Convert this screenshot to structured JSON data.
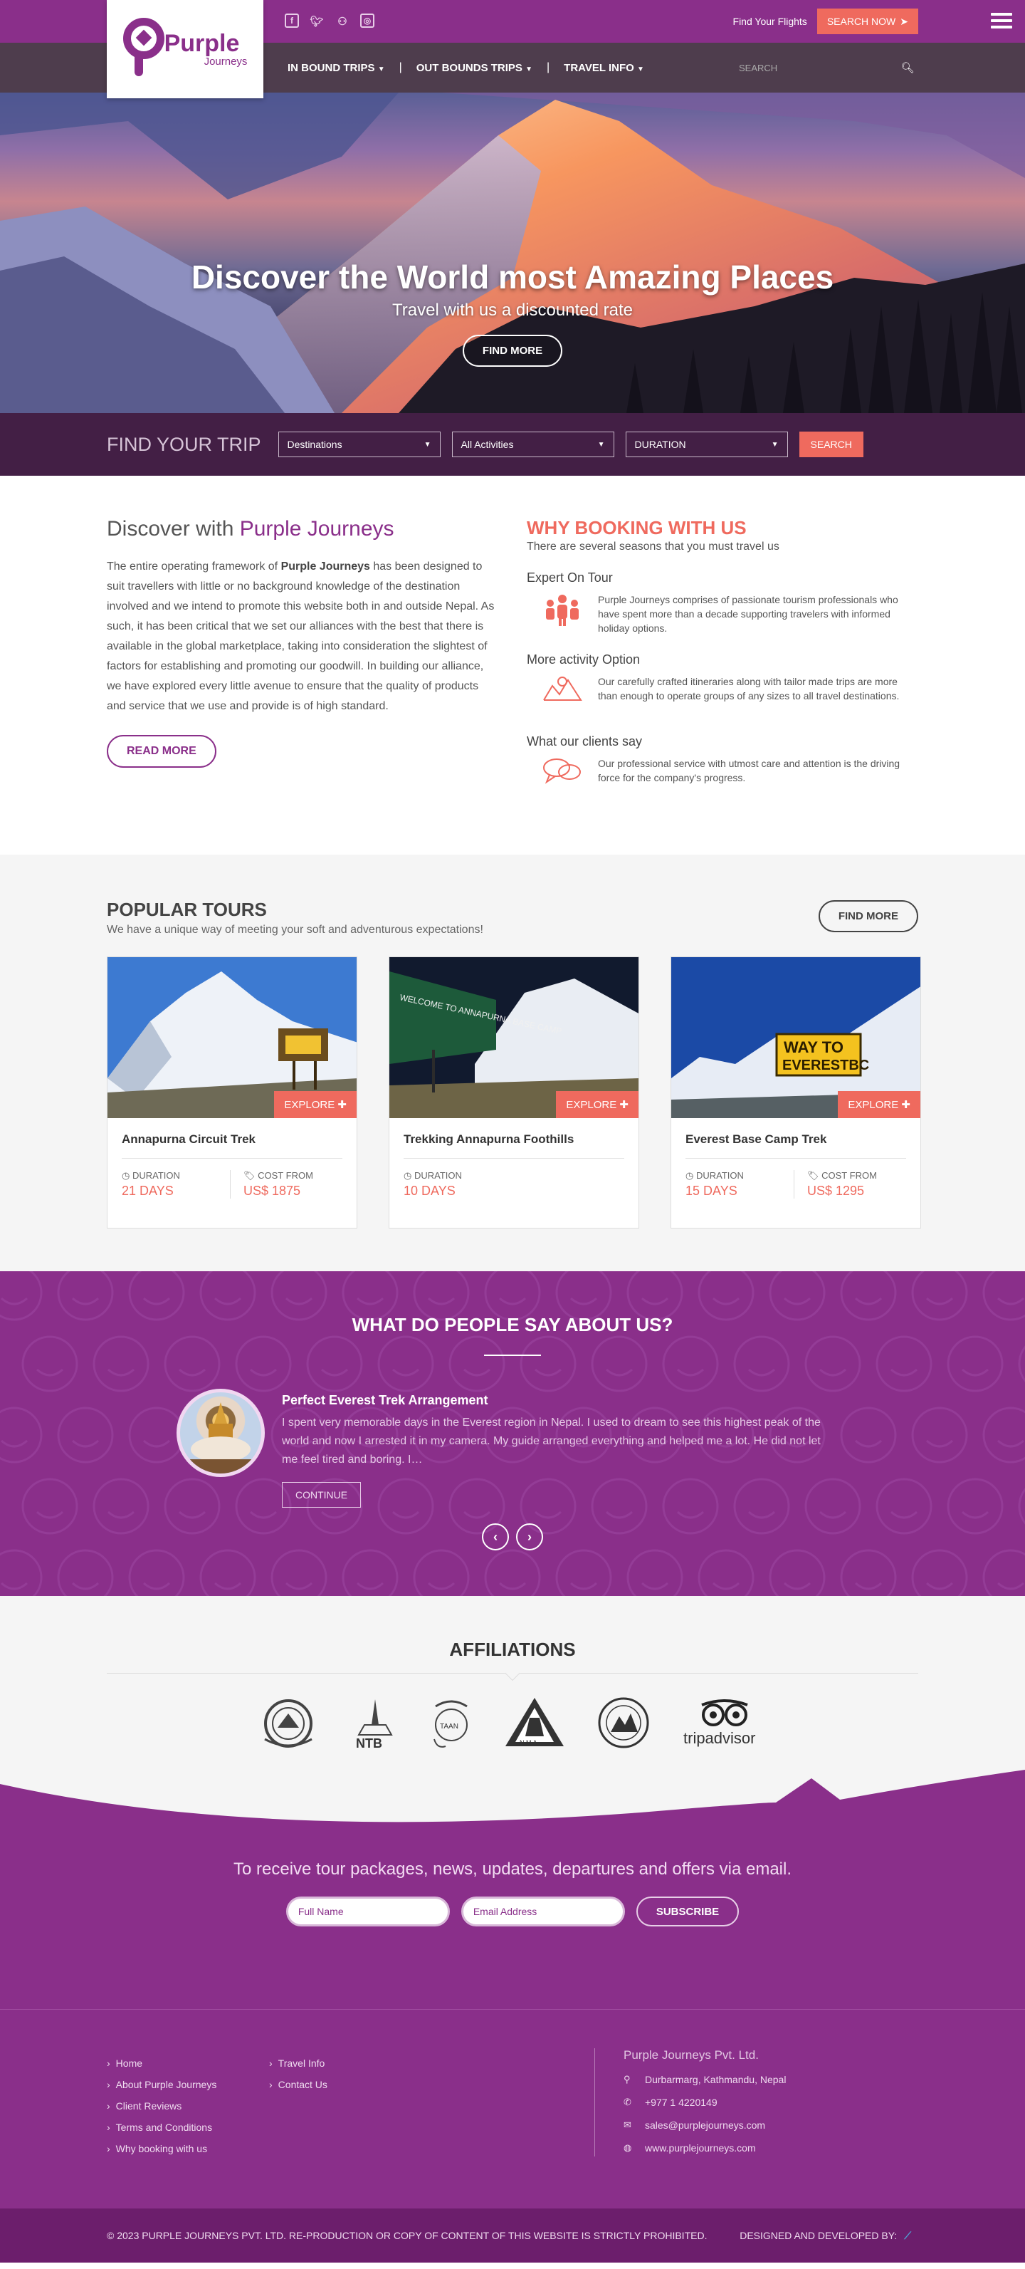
{
  "topbar": {
    "social": [
      "facebook-icon",
      "twitter-icon",
      "tripadvisor-icon",
      "instagram-icon"
    ],
    "find_flights": "Find Your Flights",
    "search_now": "SEARCH NOW"
  },
  "brand": {
    "name": "Purple",
    "tagline": "Journeys"
  },
  "nav": {
    "items": [
      "IN BOUND TRIPS",
      "OUT BOUNDS TRIPS",
      "TRAVEL INFO"
    ],
    "search_placeholder": "SEARCH"
  },
  "hero": {
    "title": "Discover the World most Amazing Places",
    "subtitle": "Travel with us a discounted rate",
    "button": "FIND MORE"
  },
  "trip_search": {
    "title": "FIND YOUR TRIP",
    "destinations": "Destinations",
    "activities": "All Activities",
    "duration": "DURATION",
    "button": "SEARCH"
  },
  "discover": {
    "heading_prefix": "Discover with ",
    "heading_brand": "Purple Journeys",
    "para_lead": "The entire operating framework of ",
    "para_bold": "Purple Journeys",
    "para_rest": " has been designed to suit travellers with little or no background knowledge of the destination involved and we intend to promote this website both in and outside Nepal. As such, it has been critical that we set our alliances with the best that there is available in the global marketplace, taking into consideration the slightest of factors for establishing and promoting our goodwill. In building our alliance, we have explored every little avenue to ensure that the quality of products and service that we use and provide is of high standard.",
    "button": "READ MORE"
  },
  "why": {
    "title": "WHY BOOKING WITH US",
    "subtitle": "There are several seasons that you must travel us",
    "features": [
      {
        "title": "Expert On Tour",
        "text": "Purple Journeys comprises of passionate tourism professionals who have spent more than a decade supporting travelers with informed holiday options."
      },
      {
        "title": "More activity Option",
        "text": "Our carefully crafted itineraries along with tailor made trips are more than enough to operate groups of any sizes to all travel destinations."
      },
      {
        "title": "What our clients say",
        "text": "Our professional service with utmost care and attention is the driving force for the company's progress."
      }
    ]
  },
  "popular": {
    "title": "POPULAR TOURS",
    "subtitle": "We have a unique way of meeting your soft and adventurous expectations!",
    "button": "FIND MORE",
    "explore": "EXPLORE",
    "duration_label": "DURATION",
    "cost_label": "COST FROM",
    "tours": [
      {
        "name": "Annapurna Circuit Trek",
        "duration": "21 DAYS",
        "cost": "US$ 1875"
      },
      {
        "name": "Trekking Annapurna Foothills",
        "duration": "10 DAYS",
        "cost": ""
      },
      {
        "name": "Everest Base Camp Trek",
        "duration": "15 DAYS",
        "cost": "US$ 1295"
      }
    ],
    "sign2": "WELCOME TO ANNAPURNA BASE CAMP",
    "sign3a": "WAY TO",
    "sign3b": "EVERESTBC"
  },
  "testimonials": {
    "title": "WHAT DO PEOPLE SAY ABOUT US?",
    "item_title": "Perfect Everest Trek Arrangement",
    "item_text": "I spent very memorable days in the Everest region in Nepal. I used to dream to see this highest peak of the world and now I arrested it in my camera. My guide arranged everything and helped me a lot. He did not let me feel tired and boring. I…",
    "button": "CONTINUE"
  },
  "affiliations": {
    "title": "AFFILIATIONS",
    "logos": [
      {
        "name": "nepal-government-emblem",
        "text": ""
      },
      {
        "name": "ntb-logo",
        "text": "NTB"
      },
      {
        "name": "taan-logo",
        "text": "TAAN"
      },
      {
        "name": "nma-logo",
        "text": "N M A"
      },
      {
        "name": "mountain-rescue-logo",
        "text": ""
      },
      {
        "name": "tripadvisor-logo",
        "text": "tripadvisor"
      }
    ]
  },
  "newsletter": {
    "title": "To receive tour packages, news, updates, departures and offers via email.",
    "name_placeholder": "Full Name",
    "email_placeholder": "Email Address",
    "button": "SUBSCRIBE"
  },
  "footer": {
    "col1": [
      "Home",
      "About Purple Journeys",
      "Client Reviews",
      "Terms and Conditions",
      "Why booking with us"
    ],
    "col2": [
      "Travel Info",
      "Contact Us"
    ],
    "company": "Purple Journeys Pvt. Ltd.",
    "address": "Durbarmarg, Kathmandu, Nepal",
    "phone": "+977 1 4220149",
    "email": "sales@purplejourneys.com",
    "web": "www.purplejourneys.com",
    "copyright": "© 2023 PURPLE JOURNEYS PVT. LTD. RE-PRODUCTION OR COPY OF CONTENT OF THIS WEBSITE IS STRICTLY PROHIBITED.",
    "designed": "DESIGNED AND DEVELOPED BY:"
  },
  "colors": {
    "purple": "#8a2f8a",
    "coral": "#ef6a5e",
    "dark_nav": "#4e3d4d"
  }
}
